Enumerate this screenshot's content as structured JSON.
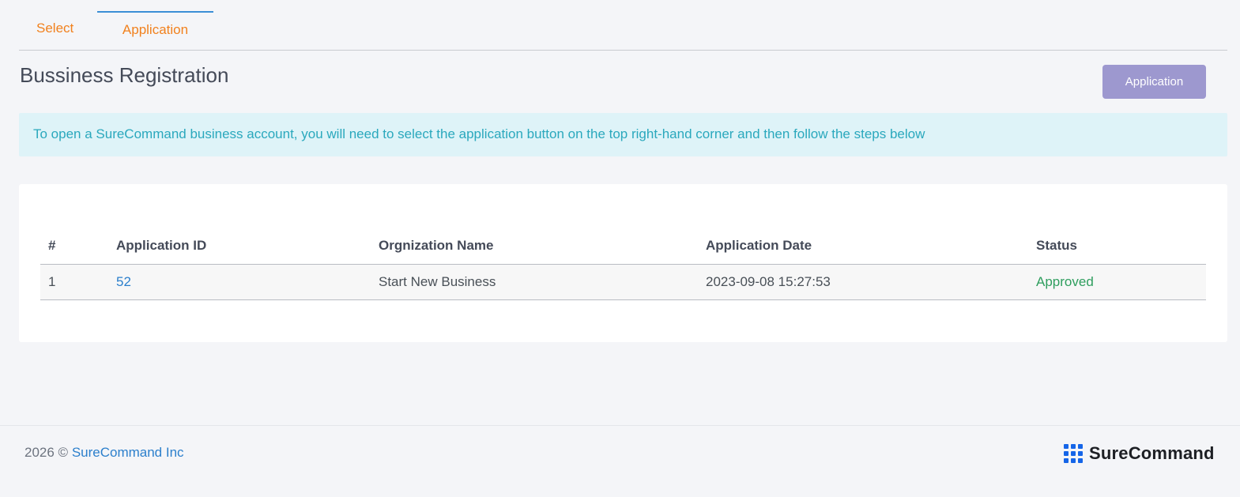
{
  "tabs": [
    {
      "label": "Select"
    },
    {
      "label": "Application"
    }
  ],
  "page": {
    "title": "Bussiness Registration",
    "application_button": "Application"
  },
  "info": {
    "text": "To open a SureCommand business account, you will need to select the application button on the top right-hand corner and then follow the steps below"
  },
  "table": {
    "headers": [
      "#",
      "Application ID",
      "Orgnization Name",
      "Application Date",
      "Status"
    ],
    "rows": [
      {
        "num": "1",
        "id": "52",
        "org": "Start New Business",
        "date": "2023-09-08 15:27:53",
        "status": "Approved"
      }
    ]
  },
  "footer": {
    "year": "2026 ©",
    "company": "SureCommand Inc",
    "brand": "SureCommand"
  },
  "colors": {
    "tab_text": "#f1811d",
    "active_tab_border": "#3b8fd6",
    "button_bg": "#9d98cf",
    "info_bg": "#def3f8",
    "info_text": "#2aa8bd",
    "link": "#2b7fcc",
    "status_approved": "#2f9e5e",
    "brand_icon": "#1565e8"
  }
}
